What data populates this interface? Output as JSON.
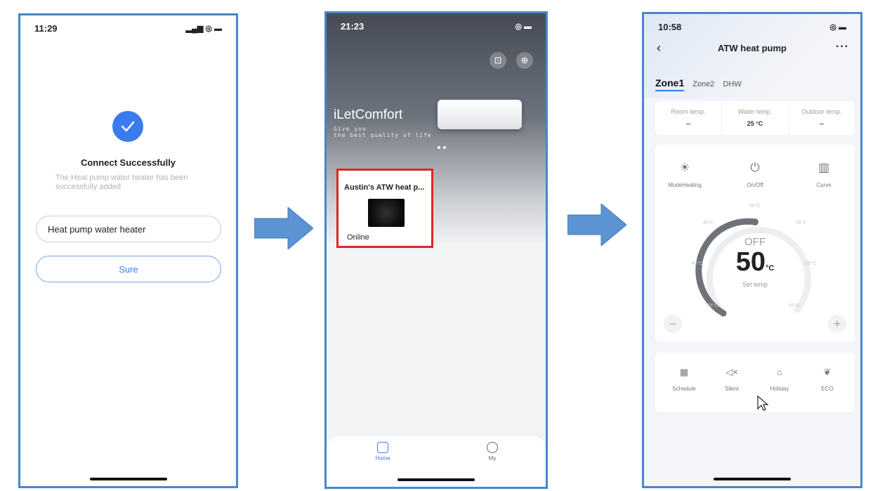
{
  "screen1": {
    "time": "11:29",
    "signal_icons": "••• ◉ ▬",
    "title": "Connect Successfully",
    "subtitle": "The Heat pump water heater has been successfully added",
    "device_name_value": "Heat pump water heater",
    "confirm_label": "Sure"
  },
  "screen2": {
    "time": "21:23",
    "brand": "iLetComfort",
    "tagline_line1": "Give you",
    "tagline_line2": "the best quality of life",
    "device_card": {
      "name": "Austin's ATW heat p...",
      "status": "Online"
    },
    "tabs": [
      {
        "label": "Home"
      },
      {
        "label": "My"
      }
    ]
  },
  "screen3": {
    "time": "10:58",
    "title": "ATW heat pump",
    "zones": [
      "Zone1",
      "Zone2",
      "DHW"
    ],
    "temps": [
      {
        "label": "Room temp.",
        "value": "--"
      },
      {
        "label": "Water temp.",
        "value": "25 °C"
      },
      {
        "label": "Outdoor temp.",
        "value": "--"
      }
    ],
    "controls": [
      {
        "label": "ModeHeating",
        "icon": "sun-icon"
      },
      {
        "label": "On/Off",
        "icon": "power-icon"
      },
      {
        "label": "Curve",
        "icon": "chart-icon"
      }
    ],
    "power_state": "OFF",
    "set_temp_value": "50",
    "set_temp_unit": "°C",
    "set_temp_label": "Set temp",
    "dial_ticks": [
      "45°C",
      "50°C",
      "55°C",
      "40°C",
      "60°C",
      "35°C",
      "65°C"
    ],
    "modes": [
      {
        "label": "Schedule",
        "icon": "calendar-icon"
      },
      {
        "label": "Silent",
        "icon": "mute-icon"
      },
      {
        "label": "Holiday",
        "icon": "suitcase-icon"
      },
      {
        "label": "ECO",
        "icon": "leaf-icon"
      }
    ]
  },
  "colors": {
    "frame": "#4a86c8",
    "accent": "#3b7bf0",
    "highlight": "#e0261c",
    "arrow": "#5b93d3"
  }
}
